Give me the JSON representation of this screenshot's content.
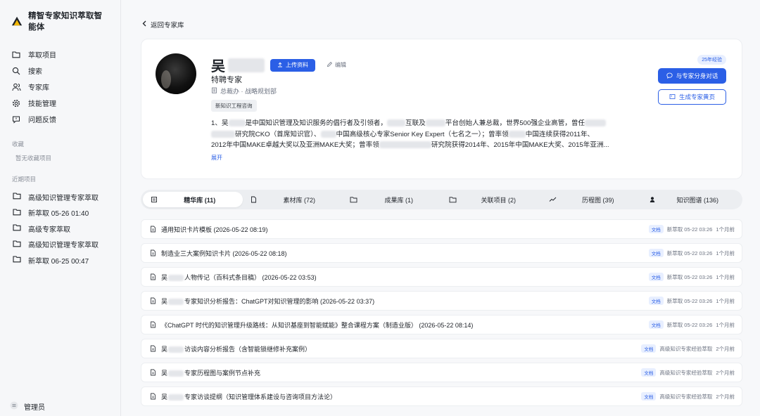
{
  "app": {
    "title": "精智专家知识萃取智能体"
  },
  "nav": [
    {
      "label": "萃取项目",
      "icon": "folder-icon"
    },
    {
      "label": "搜索",
      "icon": "search-icon"
    },
    {
      "label": "专家库",
      "icon": "users-icon"
    },
    {
      "label": "技能管理",
      "icon": "gear-icon"
    },
    {
      "label": "问题反馈",
      "icon": "message-icon"
    }
  ],
  "favorites": {
    "title": "收藏",
    "empty": "暂无收藏项目"
  },
  "recent": {
    "title": "近期项目",
    "items": [
      "高级知识管理专家萃取",
      "新萃取 05-26 01:40",
      "高级专家萃取",
      "高级知识管理专家萃取",
      "新萃取 06-25 00:47"
    ]
  },
  "user": {
    "name": "管理员"
  },
  "back": {
    "label": "返回专家库"
  },
  "profile": {
    "name": "吴",
    "upload_label": "上传资料",
    "edit_label": "编辑",
    "title": "特聘专家",
    "department": "总裁办 · 战略规划部",
    "tag": "新知识工程咨询",
    "bio_line1_a": "1、吴",
    "bio_line1_b": "是中国知识管理及知识服务的倡行者及引领者，",
    "bio_line1_c": "互联及",
    "bio_line1_d": "平台创始人兼总裁，世界500强企业高管，曾任",
    "bio_line2_a": "研究院CKO（首席知识官）、",
    "bio_line2_b": "中国高级核心专家Senior Key Expert（七名之一）；曾率领",
    "bio_line2_c": "中国连续获得2011年、",
    "bio_line3_a": "2012年中国MAKE卓越大奖以及亚洲MAKE大奖；曾率领",
    "bio_line3_b": "研究院获得2014年、2015年中国MAKE大奖、2015年亚洲...",
    "expand_label": "展开",
    "years_badge": "25年经验",
    "chat_label": "与专家分身对话",
    "page_label": "生成专家黄页"
  },
  "tabs": [
    {
      "label": "精华库 (11)",
      "icon": "layers-icon",
      "active": true
    },
    {
      "label": "素材库 (72)",
      "icon": "file-icon"
    },
    {
      "label": "成果库 (1)",
      "icon": "folder-icon"
    },
    {
      "label": "关联项目 (2)",
      "icon": "folder-icon"
    },
    {
      "label": "历程图 (39)",
      "icon": "trend-icon"
    },
    {
      "label": "知识图谱 (136)",
      "icon": "person-icon"
    }
  ],
  "rows": [
    {
      "pre": "通用知识卡片模板 (2026-05-22 08:19)",
      "post": "",
      "badge": "文档",
      "source": "新萃取 05-22 03:26",
      "time": "1个月前"
    },
    {
      "pre": "制造业三大案例知识卡片 (2026-05-22 08:18)",
      "post": "",
      "badge": "文档",
      "source": "新萃取 05-22 03:26",
      "time": "1个月前"
    },
    {
      "pre": "吴",
      "post": "人物传记（百科式条目稿） (2026-05-22 03:53)",
      "badge": "文档",
      "source": "新萃取 05-22 03:26",
      "time": "1个月前"
    },
    {
      "pre": "吴",
      "post": "专家知识分析报告：ChatGPT对知识管理的影响 (2026-05-22 03:37)",
      "badge": "文档",
      "source": "新萃取 05-22 03:26",
      "time": "1个月前"
    },
    {
      "pre": "《ChatGPT 时代的知识管理升级路线：从知识基座到智能赋能》整合课程方案（制造业版） (2026-05-22 08:14)",
      "post": "",
      "badge": "文档",
      "source": "新萃取 05-22 03:26",
      "time": "1个月前"
    },
    {
      "pre": "吴",
      "post": "访谈内容分析报告（含智能锁继修补充案例）",
      "badge": "文档",
      "source": "高级知识专家经验萃取",
      "time": "2个月前"
    },
    {
      "pre": "吴",
      "post": "专家历程图与案例节点补充",
      "badge": "文档",
      "source": "高级知识专家经验萃取",
      "time": "2个月前"
    },
    {
      "pre": "吴",
      "post": "专家访谈提纲（知识管理体系建设与咨询项目方法论）",
      "badge": "文档",
      "source": "高级知识专家经验萃取",
      "time": "2个月前"
    }
  ]
}
